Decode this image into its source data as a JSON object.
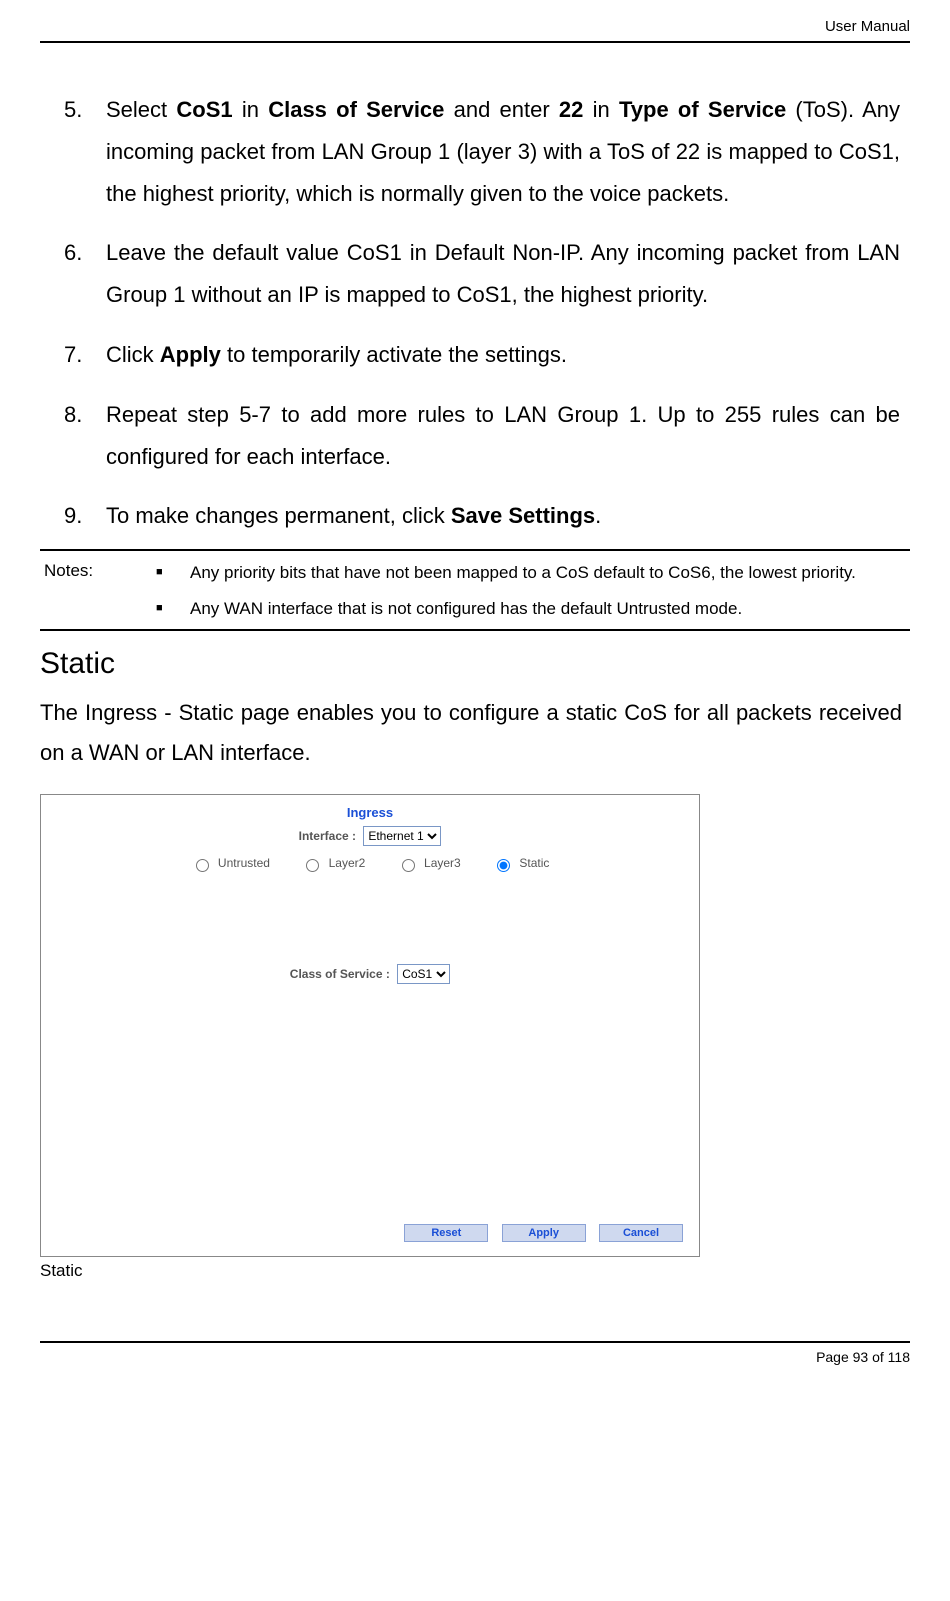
{
  "header_right": "User Manual",
  "list": {
    "i5": {
      "num": "5.",
      "pre": "Select ",
      "b1": "CoS1",
      "mid1": " in ",
      "b2": "Class of Service",
      "mid2": " and enter ",
      "b3": "22",
      "mid3": " in ",
      "b4": "Type of Service",
      "post": " (ToS). Any incoming packet from LAN Group 1 (layer 3) with a ToS of 22 is mapped to CoS1, the highest priority, which is normally given to the voice packets."
    },
    "i6": {
      "num": "6.",
      "text": "Leave the default value CoS1 in Default Non-IP. Any incoming packet from LAN Group 1 without an IP is mapped to CoS1, the highest priority."
    },
    "i7": {
      "num": "7.",
      "pre": "Click ",
      "b1": "Apply",
      "post": " to temporarily activate the settings."
    },
    "i8": {
      "num": "8.",
      "text": "Repeat step 5-7 to add more rules to LAN Group 1. Up to 255 rules can be configured for each interface."
    },
    "i9": {
      "num": "9.",
      "pre": "To make changes permanent, click ",
      "b1": "Save Settings",
      "post": "."
    }
  },
  "notes": {
    "label": "Notes:",
    "n1": "Any priority bits that have not been mapped to a CoS default to CoS6, the lowest priority.",
    "n2": "Any WAN interface that is not configured has the default Untrusted mode."
  },
  "section": {
    "title": "Static",
    "body": "The Ingress - Static page enables you to configure a static CoS for all packets received on a WAN or LAN interface."
  },
  "panel": {
    "title": "Ingress",
    "interface_label": "Interface :",
    "interface_value": "Ethernet 1",
    "radios": {
      "untrusted": "Untrusted",
      "layer2": "Layer2",
      "layer3": "Layer3",
      "static": "Static"
    },
    "cos_label": "Class of Service :",
    "cos_value": "CoS1",
    "buttons": {
      "reset": "Reset",
      "apply": "Apply",
      "cancel": "Cancel"
    }
  },
  "img_caption": "Static",
  "footer": "Page 93 of 118"
}
